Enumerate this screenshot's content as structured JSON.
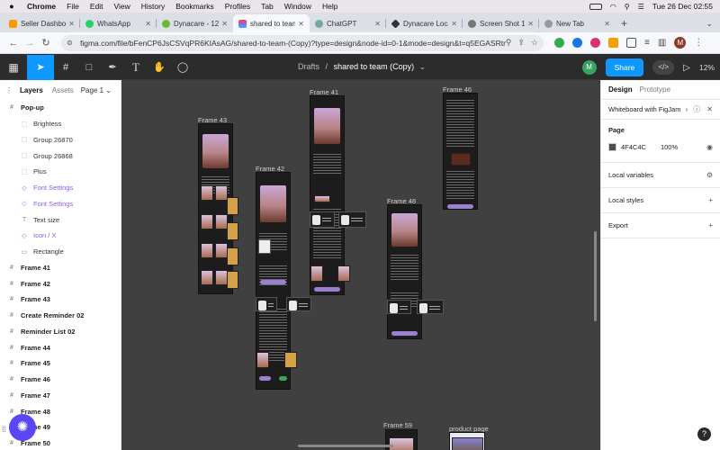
{
  "menubar": {
    "apple": "",
    "app": "Chrome",
    "items": [
      "File",
      "Edit",
      "View",
      "History",
      "Bookmarks",
      "Profiles",
      "Tab",
      "Window",
      "Help"
    ],
    "datetime": "Tue 26 Dec  02:55"
  },
  "tabs": [
    {
      "title": "Seller Dashboard",
      "color": "#ff9900"
    },
    {
      "title": "WhatsApp",
      "color": "#25d366"
    },
    {
      "title": "Dynacare - 12...",
      "color": "#66bb33"
    },
    {
      "title": "shared to team",
      "color": "#f24e1e"
    },
    {
      "title": "ChatGPT",
      "color": "#74aa9c"
    },
    {
      "title": "Dynacare Loca...",
      "color": "#333333"
    },
    {
      "title": "Screen Shot 1...",
      "color": "#777777"
    },
    {
      "title": "New Tab",
      "color": "#999999"
    }
  ],
  "toolbar": {
    "url": "figma.com/file/bFenCP6JsCSVqPR6KIAsAG/shared-to-team-(Copy)?type=design&node-id=0-1&mode=design&t=q5EGASRtrQ0..."
  },
  "figma": {
    "breadcrumb_root": "Drafts",
    "breadcrumb_sep": "/",
    "file_name": "shared to team (Copy)",
    "user_initial": "M",
    "share_label": "Share",
    "zoom": "12%"
  },
  "layers_panel": {
    "tab_layers": "Layers",
    "tab_assets": "Assets",
    "page": "Page 1",
    "items": [
      {
        "label": "Pop-up",
        "icon": "frame-icon",
        "level": 0
      },
      {
        "label": "Brightess",
        "icon": "group-icon",
        "level": 1
      },
      {
        "label": "Group 26870",
        "icon": "group-icon",
        "level": 1
      },
      {
        "label": "Group 26868",
        "icon": "group-icon",
        "level": 1
      },
      {
        "label": "Plus",
        "icon": "group-icon",
        "level": 1
      },
      {
        "label": "Font Settings",
        "icon": "component-icon",
        "level": 1,
        "purple": true
      },
      {
        "label": "Font Settings",
        "icon": "component-icon",
        "level": 1,
        "purple": true
      },
      {
        "label": "Text size",
        "icon": "text-icon",
        "level": 1
      },
      {
        "label": "Icon / X",
        "icon": "component-icon",
        "level": 1,
        "purple": true
      },
      {
        "label": "Rectangle",
        "icon": "rect-icon",
        "level": 1
      },
      {
        "label": "Frame 41",
        "icon": "frame-icon",
        "level": 0
      },
      {
        "label": "Frame 42",
        "icon": "frame-icon",
        "level": 0
      },
      {
        "label": "Frame 43",
        "icon": "frame-icon",
        "level": 0
      },
      {
        "label": "Create Reminder 02",
        "icon": "frame-icon",
        "level": 0
      },
      {
        "label": "Reminder List 02",
        "icon": "frame-icon",
        "level": 0
      },
      {
        "label": "Frame 44",
        "icon": "frame-icon",
        "level": 0
      },
      {
        "label": "Frame 45",
        "icon": "frame-icon",
        "level": 0
      },
      {
        "label": "Frame 46",
        "icon": "frame-icon",
        "level": 0
      },
      {
        "label": "Frame 47",
        "icon": "frame-icon",
        "level": 0
      },
      {
        "label": "Frame 48",
        "icon": "frame-icon",
        "level": 0
      },
      {
        "label": "Frame 49",
        "icon": "frame-icon",
        "level": 0
      },
      {
        "label": "Frame 50",
        "icon": "frame-icon",
        "level": 0
      }
    ]
  },
  "canvas": {
    "frames": [
      {
        "label": "Frame 43"
      },
      {
        "label": "Frame 42"
      },
      {
        "label": "Frame 41"
      },
      {
        "label": "Frame 48"
      },
      {
        "label": "Frame 46"
      },
      {
        "label": "Frame 59"
      },
      {
        "label": "product page"
      }
    ]
  },
  "design_panel": {
    "tab_design": "Design",
    "tab_prototype": "Prototype",
    "whiteboard": "Whiteboard with FigJam",
    "page_title": "Page",
    "page_color": "4F4C4C",
    "page_swatch": "#4f4c4c",
    "page_opacity": "100%",
    "local_variables": "Local variables",
    "local_styles": "Local styles",
    "export": "Export"
  },
  "help_label": "?"
}
